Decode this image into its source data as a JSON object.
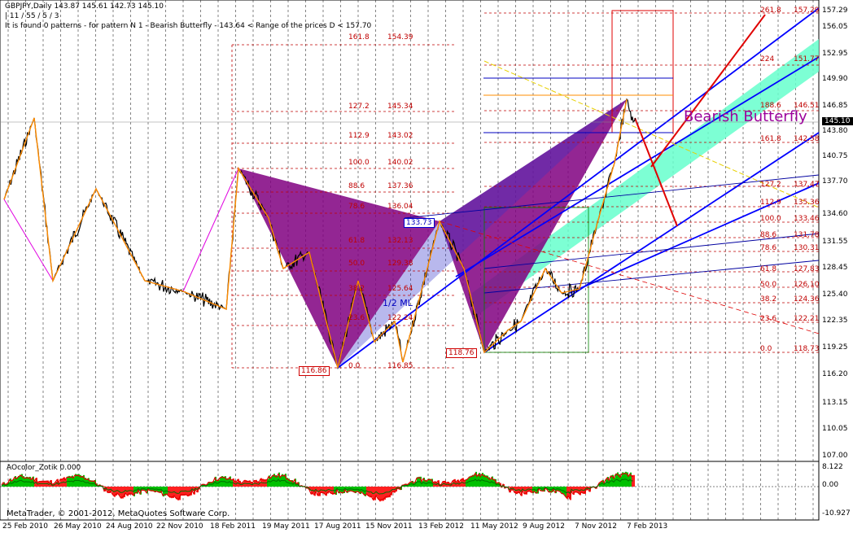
{
  "header": {
    "line1": "GBPJPY,Daily  143.87 145.61 142.73 145.10",
    "line2": "| 11 / 55 / 5 / 3",
    "line3": "It is found 0 patterns  -  for pattern N 1 - Bearish Butterfly  - 143.64 < Range of the prices D < 157.70"
  },
  "price_axis": [
    "157.29",
    "156.05",
    "152.95",
    "149.90",
    "146.85",
    "143.80",
    "140.75",
    "137.70",
    "134.60",
    "131.55",
    "128.45",
    "125.40",
    "122.35",
    "119.25",
    "116.20",
    "113.15",
    "110.05",
    "107.00"
  ],
  "current_price": "145.10",
  "time_axis": [
    "25 Feb 2010",
    "26 May 2010",
    "24 Aug 2010",
    "22 Nov 2010",
    "18 Feb 2011",
    "19 May 2011",
    "17 Aug 2011",
    "15 Nov 2011",
    "13 Feb 2012",
    "11 May 2012",
    "9 Aug 2012",
    "7 Nov 2012",
    "7 Feb 2013"
  ],
  "pattern_label": "Bearish Butterfly",
  "median_line_label": "1/2 ML",
  "left_fib_levels": [
    {
      "ratio": "161.8",
      "price": "154.39"
    },
    {
      "ratio": "127.2",
      "price": "145.34"
    },
    {
      "ratio": "112.9",
      "price": "143.02"
    },
    {
      "ratio": "100.0",
      "price": "140.02"
    },
    {
      "ratio": "88.6",
      "price": "137.36"
    },
    {
      "ratio": "78.6",
      "price": "136.04"
    },
    {
      "ratio": "61.8",
      "price": "132.13"
    },
    {
      "ratio": "50.0",
      "price": "129.38"
    },
    {
      "ratio": "38.2",
      "price": "125.64"
    },
    {
      "ratio": "23.6",
      "price": "122.24"
    },
    {
      "ratio": "0.0",
      "price": "116.85"
    }
  ],
  "right_fib_levels": [
    {
      "ratio": "261.8",
      "price": "157.29"
    },
    {
      "ratio": "224",
      "price": "151.77"
    },
    {
      "ratio": "188.6",
      "price": "146.51"
    },
    {
      "ratio": "161.8",
      "price": "142.58"
    },
    {
      "ratio": "127.2",
      "price": "137.47"
    },
    {
      "ratio": "112.9",
      "price": "135.36"
    },
    {
      "ratio": "100.0",
      "price": "133.46"
    },
    {
      "ratio": "88.6",
      "price": "131.78"
    },
    {
      "ratio": "78.6",
      "price": "130.31"
    },
    {
      "ratio": "61.8",
      "price": "127.83"
    },
    {
      "ratio": "50.0",
      "price": "126.10"
    },
    {
      "ratio": "38.2",
      "price": "124.36"
    },
    {
      "ratio": "23.6",
      "price": "122.21"
    },
    {
      "ratio": "0.0",
      "price": "118.73"
    }
  ],
  "price_boxes": {
    "x_low": "116.86",
    "b_point": "133.73",
    "c_low": "118.76"
  },
  "oscillator": {
    "label": "AOcolor_Zotik 0.000",
    "axis": [
      "8.122",
      "0.00",
      "-10.927"
    ]
  },
  "footer": "MetaTrader, © 2001-2012, MetaQuotes Software Corp.",
  "colors": {
    "pattern_fill": "#800080",
    "channel": "#0000ff",
    "fib_text": "#c00000",
    "band": "#66ffcc",
    "price_line": "#000000",
    "zigzag": "#ff8c00"
  }
}
